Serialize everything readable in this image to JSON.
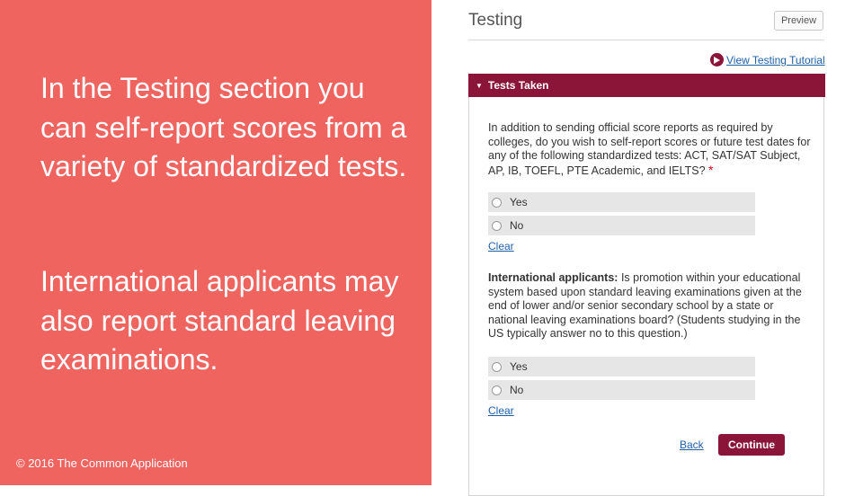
{
  "left_panel": {
    "paragraph_1": "In the Testing section you can self-report scores from a variety of standardized tests.",
    "paragraph_2": "International applicants may also report standard leaving examinations.",
    "copyright": "© 2016 The Common Application",
    "background_color": "#f06460"
  },
  "form": {
    "title": "Testing",
    "preview_label": "Preview",
    "tutorial_label": "View Testing Tutorial",
    "section_header": "Tests Taken",
    "question_1": {
      "text": "In addition to sending official score reports as required by colleges, do you wish to self-report scores or future test dates for any of the following standardized tests: ACT, SAT/SAT Subject, AP, IB, TOEFL, PTE Academic, and IELTS?",
      "required_marker": "*",
      "options": [
        "Yes",
        "No"
      ],
      "clear_label": "Clear"
    },
    "question_2": {
      "bold_prefix": "International applicants:",
      "text": " Is promotion within your educational system based upon standard leaving examinations given at the end of lower and/or senior secondary school by a state or national leaving examinations board? (Students studying in the US typically answer no to this question.)",
      "options": [
        "Yes",
        "No"
      ],
      "clear_label": "Clear"
    },
    "back_label": "Back",
    "continue_label": "Continue",
    "accent_color": "#8b1538",
    "link_color": "#1f5fa8"
  }
}
